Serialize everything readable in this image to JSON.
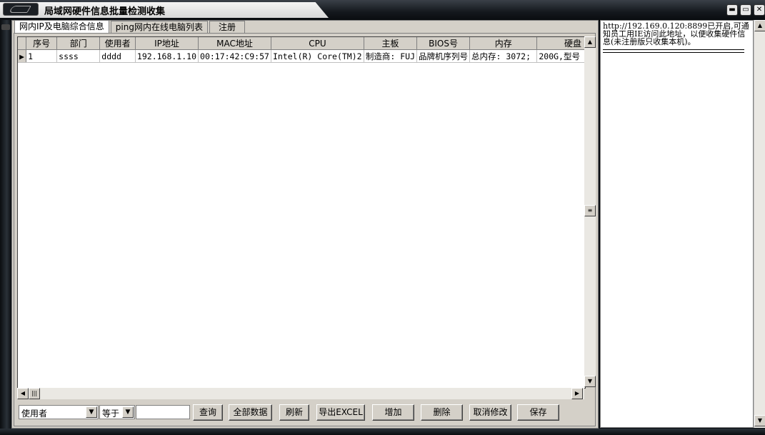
{
  "window": {
    "title": "局域网硬件信息批量检测收集",
    "controls": [
      "minimize-icon",
      "maximize-icon",
      "close-icon"
    ]
  },
  "tabs": [
    {
      "label": "网内IP及电脑综合信息",
      "active": true
    },
    {
      "label": "ping网内在线电脑列表",
      "active": false
    },
    {
      "label": "注册",
      "active": false
    }
  ],
  "grid": {
    "columns": [
      "序号",
      "部门",
      "使用者",
      "IP地址",
      "MAC地址",
      "CPU",
      "主板",
      "BIOS号",
      "内存",
      "硬盘"
    ],
    "rows": [
      [
        "1",
        "ssss",
        "dddd",
        "192.168.1.10",
        "00:17:42:C9:57",
        "Intel(R) Core(TM)2",
        "制造商: FUJ",
        "品牌机序列号",
        "总内存: 3072;",
        "200G,型号"
      ]
    ]
  },
  "filter": {
    "field_value": "使用者",
    "operator_value": "等于",
    "search_value": ""
  },
  "buttons": {
    "query": "查询",
    "all_data": "全部数据",
    "refresh": "刷新",
    "export_excel": "导出EXCEL",
    "add": "增加",
    "delete": "删除",
    "cancel_edit": "取消修改",
    "save": "保存"
  },
  "info_panel": {
    "text": "http://192.169.0.120:8899已开启,可通知员工用IE访问此地址，以便收集硬件信息(未注册版只收集本机)。"
  }
}
